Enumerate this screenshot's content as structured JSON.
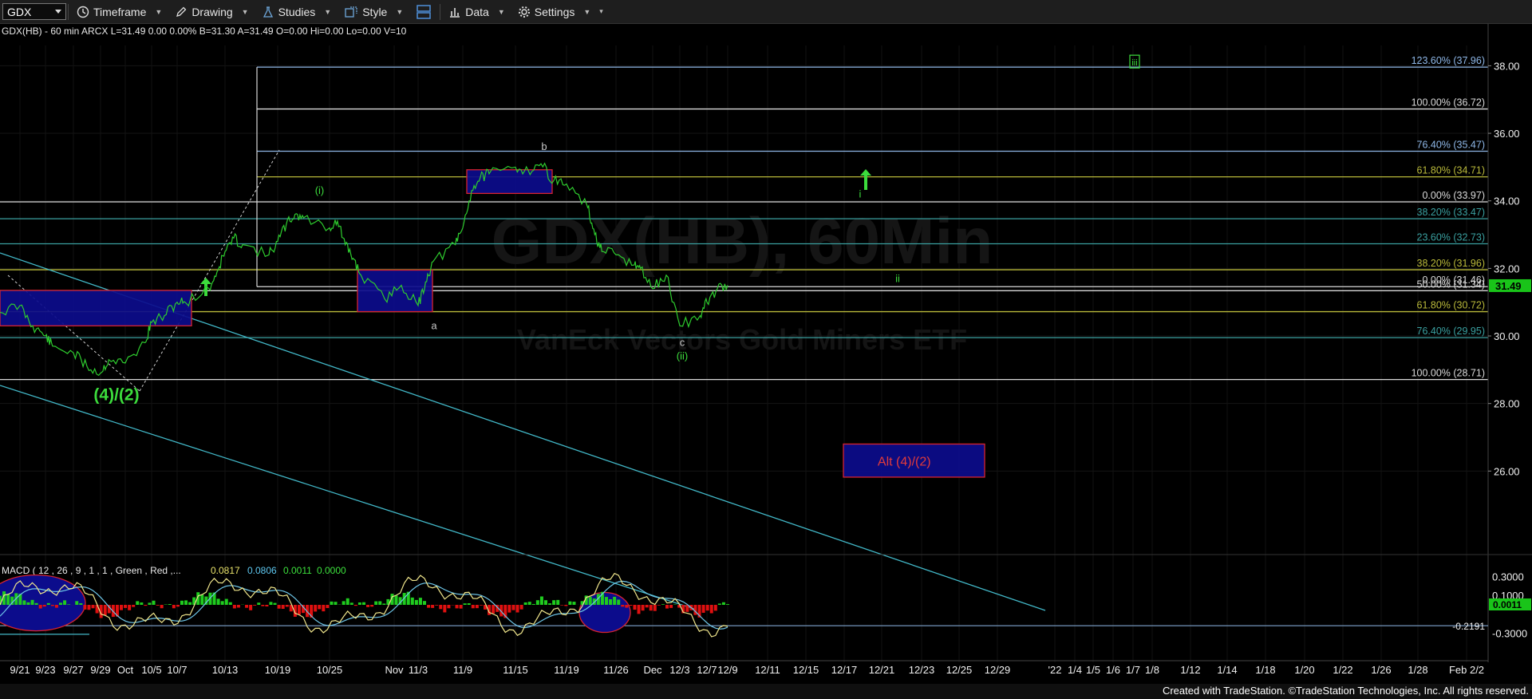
{
  "toolbar": {
    "symbol": "GDX",
    "items": [
      "Timeframe",
      "Drawing",
      "Studies",
      "Style",
      "Data",
      "Settings"
    ]
  },
  "header": {
    "info": "GDX(HB) - 60 min  ARCX  L=31.49  0.00  0.00%  B=31.30  A=31.49  O=0.00  Hi=0.00  Lo=0.00  V=10"
  },
  "watermark": {
    "title": "GDX(HB), 60Min",
    "subtitle": "VanEck Vectors Gold Miners ETF"
  },
  "colors": {
    "background": "#000000",
    "price_line": "#2ecc2e",
    "last_price_tag": "#19c419",
    "box_fill": "#0c0c8c",
    "box_border": "#d8232f",
    "trendline": "#42b8c8",
    "macd_line": "#f0e68c",
    "signal_line": "#6ec6e8",
    "hist_pos": "#1fcc1f",
    "hist_neg": "#e01010",
    "fib_white": "#d9d9d9",
    "fib_blue": "#8fb8e8",
    "fib_olive": "#b9b93a",
    "fib_teal": "#3aa0a0",
    "wave_green": "#3cdc3c"
  },
  "chart_data": {
    "type": "line",
    "title": "GDX(HB) - 60 min",
    "price_axis": {
      "ylim": [
        24.0,
        38.6
      ],
      "ticks": [
        26,
        28,
        30,
        32,
        34,
        36,
        38
      ],
      "tick_labels": [
        "26.00",
        "28.00",
        "30.00",
        "32.00",
        "34.00",
        "36.00",
        "38.00"
      ],
      "last_price": 31.49,
      "last_price_label": "31.49"
    },
    "x_axis": {
      "labels": [
        "9/21",
        "9/23",
        "9/27",
        "9/29",
        "Oct",
        "10/5",
        "10/7",
        "10/13",
        "10/19",
        "10/25",
        "Nov",
        "11/3",
        "11/9",
        "11/15",
        "11/19",
        "11/26",
        "Dec",
        "12/3",
        "12/7",
        "12/9",
        "12/11",
        "12/15",
        "12/17",
        "12/21",
        "12/23",
        "12/25",
        "12/29",
        "'22",
        "1/4",
        "1/5",
        "1/6",
        "1/7",
        "1/8",
        "1/12",
        "1/14",
        "1/18",
        "1/20",
        "1/22",
        "1/26",
        "1/28",
        "Feb 2/2"
      ]
    },
    "price_series": {
      "name": "GDX",
      "x": [
        "9/20",
        "9/21",
        "9/22",
        "9/23",
        "9/24",
        "9/27",
        "9/28",
        "9/29",
        "9/30",
        "10/1",
        "10/4",
        "10/5",
        "10/6",
        "10/7",
        "10/8",
        "10/11",
        "10/12",
        "10/13",
        "10/14",
        "10/15",
        "10/18",
        "10/19",
        "10/20",
        "10/21",
        "10/22",
        "10/25",
        "10/26",
        "10/27",
        "10/28",
        "10/29",
        "11/1",
        "11/2",
        "11/3",
        "11/4",
        "11/5",
        "11/8",
        "11/9",
        "11/10",
        "11/11",
        "11/12",
        "11/15",
        "11/16",
        "11/17",
        "11/18",
        "11/19",
        "11/22",
        "11/23",
        "11/24",
        "11/26",
        "11/29",
        "11/30",
        "12/1",
        "12/2",
        "12/3",
        "12/6",
        "12/7",
        "12/8",
        "12/9"
      ],
      "close": [
        30.7,
        30.9,
        30.3,
        30.0,
        29.7,
        29.5,
        29.1,
        28.9,
        29.3,
        29.2,
        29.8,
        30.4,
        30.6,
        31.0,
        31.0,
        31.4,
        31.9,
        32.5,
        32.9,
        32.7,
        32.4,
        32.8,
        33.3,
        33.6,
        33.5,
        33.2,
        33.4,
        32.7,
        32.3,
        31.8,
        31.1,
        31.5,
        30.9,
        31.6,
        32.2,
        32.7,
        33.2,
        34.3,
        34.7,
        34.8,
        35.0,
        34.9,
        35.1,
        34.6,
        34.5,
        33.8,
        33.0,
        32.5,
        32.4,
        32.1,
        32.0,
        31.4,
        31.8,
        30.3,
        30.6,
        31.0,
        31.4,
        31.5
      ]
    },
    "fib_levels": [
      {
        "label": "123.60% (37.96)",
        "value": 37.96
      },
      {
        "label": "100.00% (36.72)",
        "value": 36.72
      },
      {
        "label": "76.40% (35.47)",
        "value": 35.47
      },
      {
        "label": "61.80% (34.71)",
        "value": 34.71
      },
      {
        "label": "0.00% (33.97)",
        "value": 33.97
      },
      {
        "label": "38.20% (33.47)",
        "value": 33.47
      },
      {
        "label": "23.60% (32.73)",
        "value": 32.73
      },
      {
        "label": "38.20% (31.96)",
        "value": 31.96
      },
      {
        "label": "0.00% (31.46)",
        "value": 31.46
      },
      {
        "label": "50.00% (31.34)",
        "value": 31.34
      },
      {
        "label": "61.80% (30.72)",
        "value": 30.72
      },
      {
        "label": "76.40% (29.95)",
        "value": 29.95
      },
      {
        "label": "100.00% (28.71)",
        "value": 28.71
      }
    ],
    "wave_labels": [
      {
        "text": "(4)/(2)",
        "x": "9/29",
        "y": 28.1,
        "size": "large"
      },
      {
        "text": "(i)",
        "x": "10/22",
        "y": 34.2
      },
      {
        "text": "a",
        "x": "11/3",
        "y": 30.2
      },
      {
        "text": "b",
        "x": "11/16",
        "y": 35.5
      },
      {
        "text": "c",
        "x": "12/2",
        "y": 29.7
      },
      {
        "text": "(ii)",
        "x": "12/2",
        "y": 29.3
      },
      {
        "text": "i",
        "x": "12/17",
        "y": 34.1
      },
      {
        "text": "ii",
        "x": "12/21",
        "y": 31.6
      },
      {
        "text": "iii",
        "x": "1/7",
        "y": 38.1
      },
      {
        "text": "Alt (4)/(2)",
        "x": "12/20",
        "y": 26.4
      }
    ],
    "macd": {
      "label": "MACD ( 12 , 26 , 9 , 1 , 1 , Green , Red ,...",
      "values": [
        "0.0817",
        "0.0806",
        "0.0011",
        "0.0000"
      ],
      "ticks": [
        0.3,
        0.1,
        -0.3
      ],
      "tick_labels": [
        "0.3000",
        "0.1000",
        "-0.3000"
      ],
      "current_tag": "0.0011",
      "ref_level": -0.2191,
      "ref_label": "-0.2191",
      "ylim": [
        -0.42,
        0.42
      ]
    }
  },
  "footer": {
    "credit": "Created with TradeStation. ©TradeStation Technologies, Inc. All rights reserved."
  }
}
